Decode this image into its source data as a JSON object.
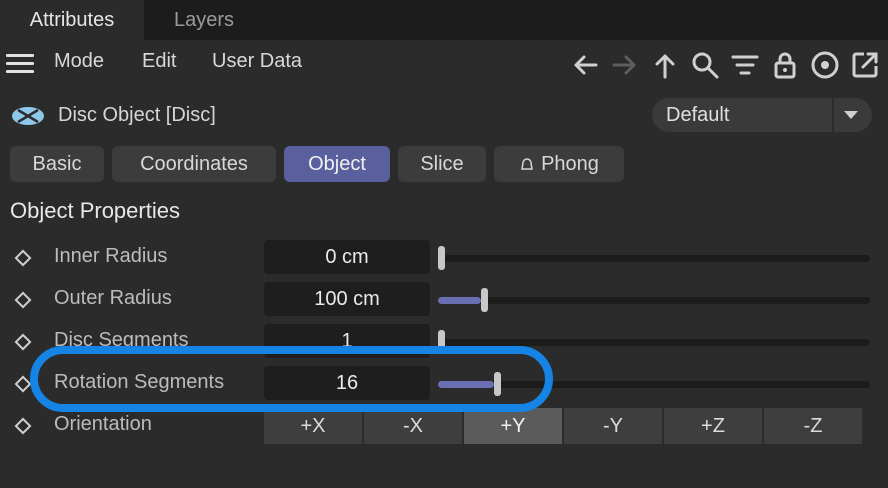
{
  "tabs": [
    {
      "label": "Attributes",
      "active": true
    },
    {
      "label": "Layers",
      "active": false
    }
  ],
  "toolbar": {
    "menu": [
      "Mode",
      "Edit",
      "User Data"
    ],
    "icons": [
      "back-arrow-icon",
      "forward-arrow-icon",
      "up-arrow-icon",
      "search-icon",
      "filter-icon",
      "lock-icon",
      "target-icon",
      "new-window-icon"
    ]
  },
  "object": {
    "title": "Disc Object [Disc]",
    "icon": "disc-icon",
    "preset": "Default"
  },
  "subtabs": [
    {
      "label": "Basic",
      "active": false
    },
    {
      "label": "Coordinates",
      "active": false
    },
    {
      "label": "Object",
      "active": true
    },
    {
      "label": "Slice",
      "active": false
    },
    {
      "label": "Phong",
      "active": false
    }
  ],
  "section": {
    "title": "Object Properties"
  },
  "properties": [
    {
      "label": "Inner Radius",
      "value": "0 cm",
      "slider_fraction": 0.0
    },
    {
      "label": "Outer Radius",
      "value": "100 cm",
      "slider_fraction": 0.1
    },
    {
      "label": "Disc Segments",
      "value": "1",
      "slider_fraction": 0.0
    },
    {
      "label": "Rotation Segments",
      "value": "16",
      "slider_fraction": 0.13
    }
  ],
  "orientation": {
    "label": "Orientation",
    "options": [
      "+X",
      "-X",
      "+Y",
      "-Y",
      "+Z",
      "-Z"
    ],
    "selected": "+Y"
  },
  "colors": {
    "accent": "#5a5f9e",
    "highlight": "#1584e4"
  }
}
